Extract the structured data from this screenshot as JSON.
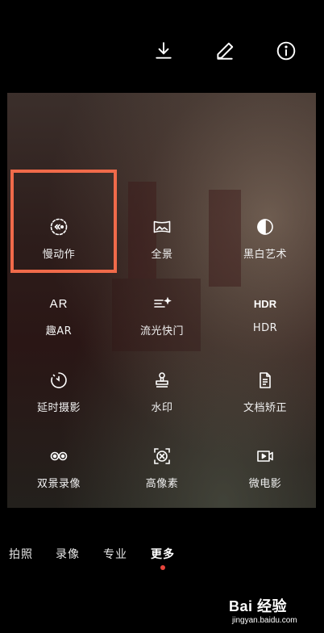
{
  "toolbar": {
    "download_icon": "download-icon",
    "edit_icon": "pencil-icon",
    "info_icon": "info-icon"
  },
  "modes": [
    {
      "label": "慢动作",
      "icon": "slow-motion-icon"
    },
    {
      "label": "全景",
      "icon": "panorama-icon"
    },
    {
      "label": "黑白艺术",
      "icon": "monochrome-icon"
    },
    {
      "label": "趣AR",
      "icon": "ar-icon",
      "icon_text": "AR"
    },
    {
      "label": "流光快门",
      "icon": "light-painting-icon"
    },
    {
      "label": "HDR",
      "icon": "hdr-icon",
      "icon_text": "HDR"
    },
    {
      "label": "延时摄影",
      "icon": "time-lapse-icon"
    },
    {
      "label": "水印",
      "icon": "watermark-stamp-icon"
    },
    {
      "label": "文档矫正",
      "icon": "document-icon"
    },
    {
      "label": "双景录像",
      "icon": "dual-view-icon"
    },
    {
      "label": "高像素",
      "icon": "high-resolution-icon"
    },
    {
      "label": "微电影",
      "icon": "micro-movie-icon"
    }
  ],
  "tabs": [
    {
      "label": "拍照",
      "active": false
    },
    {
      "label": "录像",
      "active": false
    },
    {
      "label": "专业",
      "active": false
    },
    {
      "label": "更多",
      "active": true
    }
  ],
  "watermark": {
    "brand": "Bai 经验",
    "url": "jingyan.baidu.com"
  },
  "colors": {
    "highlight": "#f06a4a",
    "active_dot": "#e8453c"
  }
}
